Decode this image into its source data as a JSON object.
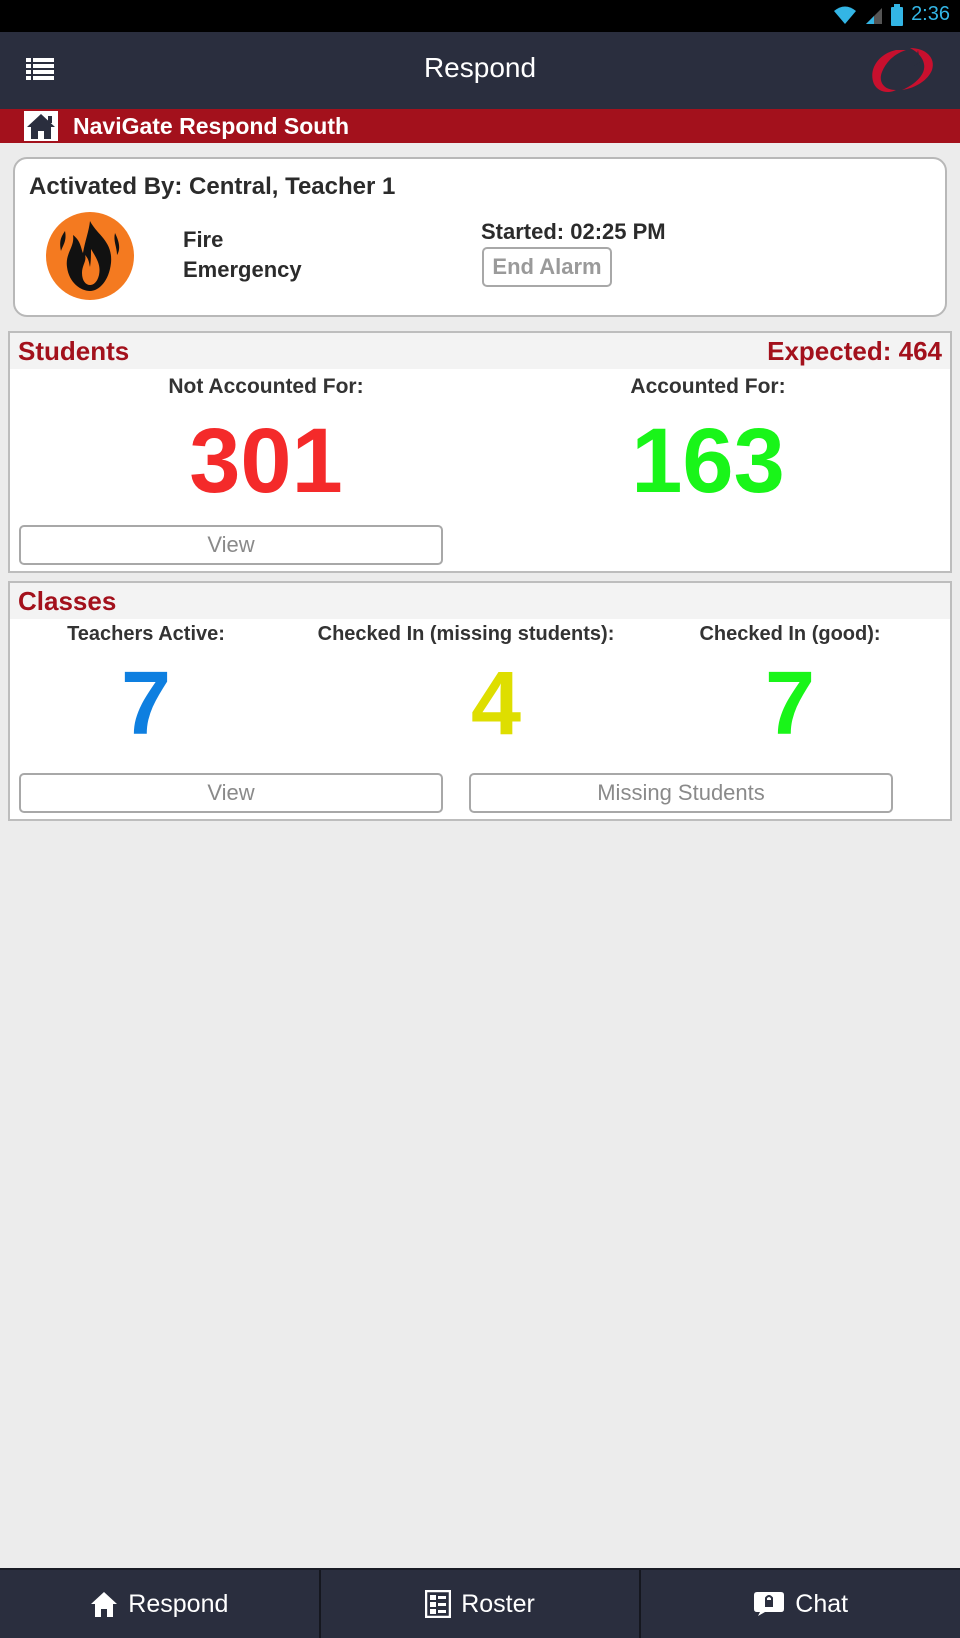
{
  "status_bar": {
    "time": "2:36",
    "accent_color": "#33b5e5"
  },
  "app_bar": {
    "title": "Respond",
    "menu_icon": "list-menu-icon",
    "logo_icon": "navigate-logo-icon"
  },
  "location": {
    "name": "NaviGate Respond South",
    "icon": "home-icon"
  },
  "alarm": {
    "activated_by": "Activated By: Central, Teacher 1",
    "type_line1": "Fire",
    "type_line2": "Emergency",
    "started": "Started: 02:25 PM",
    "end_button": "End Alarm",
    "icon": "fire-icon"
  },
  "students": {
    "title": "Students",
    "expected": "Expected: 464",
    "not_accounted_label": "Not Accounted For:",
    "not_accounted_value": "301",
    "accounted_label": "Accounted For:",
    "accounted_value": "163",
    "view_button": "View"
  },
  "classes": {
    "title": "Classes",
    "teachers_active_label": "Teachers Active:",
    "teachers_active_value": "7",
    "checked_missing_label": "Checked In (missing students):",
    "checked_missing_value": "4",
    "checked_good_label": "Checked In (good):",
    "checked_good_value": "7",
    "view_button": "View",
    "missing_button": "Missing Students"
  },
  "bottom_nav": [
    {
      "label": "Respond",
      "icon": "home-icon"
    },
    {
      "label": "Roster",
      "icon": "roster-icon"
    },
    {
      "label": "Chat",
      "icon": "chat-icon"
    }
  ],
  "colors": {
    "brand_red": "#a3111c",
    "not_accounted": "#f42a2a",
    "accounted": "#19f519",
    "teachers": "#0e7fe0",
    "missing": "#dede00",
    "good": "#19f519",
    "bar_dark": "#2a2e3e"
  }
}
